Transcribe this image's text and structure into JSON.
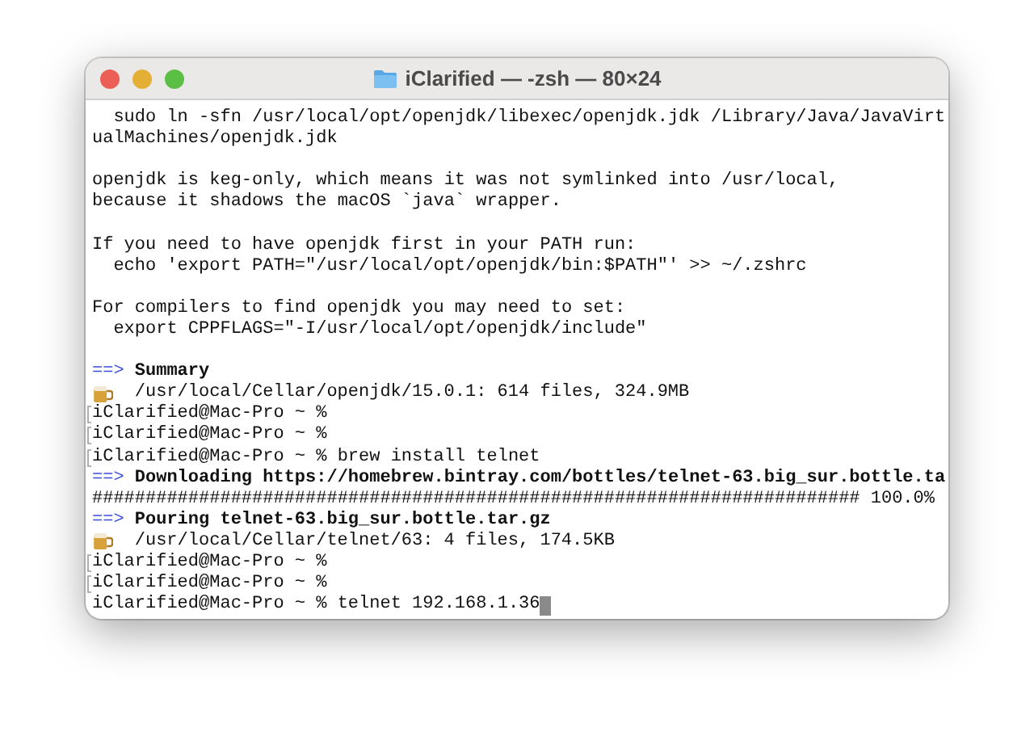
{
  "window": {
    "title": "iClarified — -zsh — 80×24"
  },
  "lines": [
    {
      "kind": "text",
      "text": "  sudo ln -sfn /usr/local/opt/openjdk/libexec/openjdk.jdk /Library/Java/JavaVirt"
    },
    {
      "kind": "text",
      "text": "ualMachines/openjdk.jdk"
    },
    {
      "kind": "blank"
    },
    {
      "kind": "text",
      "text": "openjdk is keg-only, which means it was not symlinked into /usr/local,"
    },
    {
      "kind": "text",
      "text": "because it shadows the macOS `java` wrapper."
    },
    {
      "kind": "blank"
    },
    {
      "kind": "text",
      "text": "If you need to have openjdk first in your PATH run:"
    },
    {
      "kind": "text",
      "text": "  echo 'export PATH=\"/usr/local/opt/openjdk/bin:$PATH\"' >> ~/.zshrc"
    },
    {
      "kind": "blank"
    },
    {
      "kind": "text",
      "text": "For compilers to find openjdk you may need to set:"
    },
    {
      "kind": "text",
      "text": "  export CPPFLAGS=\"-I/usr/local/opt/openjdk/include\""
    },
    {
      "kind": "blank"
    },
    {
      "kind": "heading",
      "arrow": "==>",
      "text": "Summary"
    },
    {
      "kind": "beer",
      "text": "/usr/local/Cellar/openjdk/15.0.1: 614 files, 324.9MB"
    },
    {
      "kind": "prompt",
      "marked": true,
      "text": "iClarified@Mac-Pro ~ %"
    },
    {
      "kind": "prompt",
      "marked": true,
      "text": "iClarified@Mac-Pro ~ %"
    },
    {
      "kind": "prompt",
      "marked": true,
      "text": "iClarified@Mac-Pro ~ % brew install telnet"
    },
    {
      "kind": "heading",
      "arrow": "==>",
      "text": "Downloading https://homebrew.bintray.com/bottles/telnet-63.big_sur.bottle.ta"
    },
    {
      "kind": "text",
      "text": "######################################################################## 100.0%"
    },
    {
      "kind": "heading",
      "arrow": "==>",
      "text": "Pouring telnet-63.big_sur.bottle.tar.gz"
    },
    {
      "kind": "beer",
      "text": "/usr/local/Cellar/telnet/63: 4 files, 174.5KB"
    },
    {
      "kind": "prompt",
      "marked": true,
      "text": "iClarified@Mac-Pro ~ %"
    },
    {
      "kind": "prompt",
      "marked": true,
      "text": "iClarified@Mac-Pro ~ %"
    },
    {
      "kind": "prompt",
      "marked": false,
      "cursor": true,
      "text": "iClarified@Mac-Pro ~ % telnet 192.168.1.36"
    }
  ]
}
